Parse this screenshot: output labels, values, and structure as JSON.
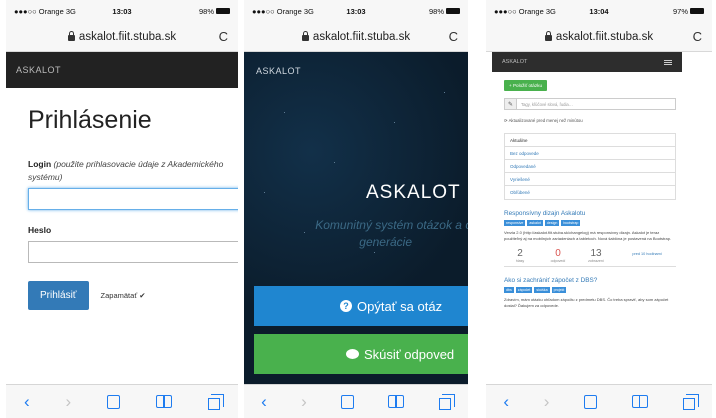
{
  "status": {
    "carrier": "●●●○○ Orange  3G",
    "times": [
      "13:03",
      "13:03",
      "13:04"
    ],
    "battery": [
      "98%",
      "98%",
      "97%"
    ]
  },
  "browser": {
    "url": "askalot.fiit.stuba.sk",
    "reload": "C"
  },
  "brand": "ASKALOT",
  "login": {
    "title": "Prihlásenie",
    "login_label": "Login",
    "login_hint": "(použite prihlasovacie údaje z Akademického",
    "login_hint_2": "systému)",
    "password_label": "Heslo",
    "submit_label": "Prihlásiť",
    "remember_label": "Zapamätať ✔"
  },
  "landing": {
    "brand_big": "ASKALOT",
    "subtitle_line1": "Komunitný systém otázok a oc",
    "subtitle_line2": "generácie",
    "ask_button": "Opýtať sa otáz",
    "answer_button": "Skúsiť odpoved"
  },
  "questions": {
    "nav_brand": "ASKALOT",
    "new_question_button": "+ Položiť otázku",
    "search_placeholder": "Tagy, kľúčové slová, ľudia…",
    "refresh_text": "Aktualizované pred menej než minútou",
    "filters": [
      "Aktuálne",
      "Bez odpovede",
      "Odpovedané",
      "Vyriešené",
      "Obľúbené"
    ],
    "q1": {
      "title": "Responsívny dizajn Askalotu",
      "tags": [
        "responsive",
        "askalot",
        "design",
        "bootstrap"
      ],
      "body": "Verzia 2.0 (http://askalot.fiit.stuba.sk/changelog) má responsívny dizajn. Askalot je teraz použiteľný aj na mobilných zariadeniach a tabletoch. Nová šablóna je postavená na Bootstrap.",
      "stats": [
        {
          "num": "2",
          "label": "hlasy"
        },
        {
          "num": "0",
          "label": "odpovedí"
        },
        {
          "num": "13",
          "label": "zobrazení"
        }
      ],
      "link": "pred 10 hodinami"
    },
    "q2": {
      "title": "Ako si zachrániť zápočet z DBS?",
      "tags": [
        "dbs",
        "zápočet",
        "skúška",
        "projekt"
      ],
      "body": "Zdravím, mám otázku ohľadom zápočtu z predmetu DBS. Čo treba spraviť, aby som zápočet dostal? Ďakujem za odpovede."
    }
  }
}
